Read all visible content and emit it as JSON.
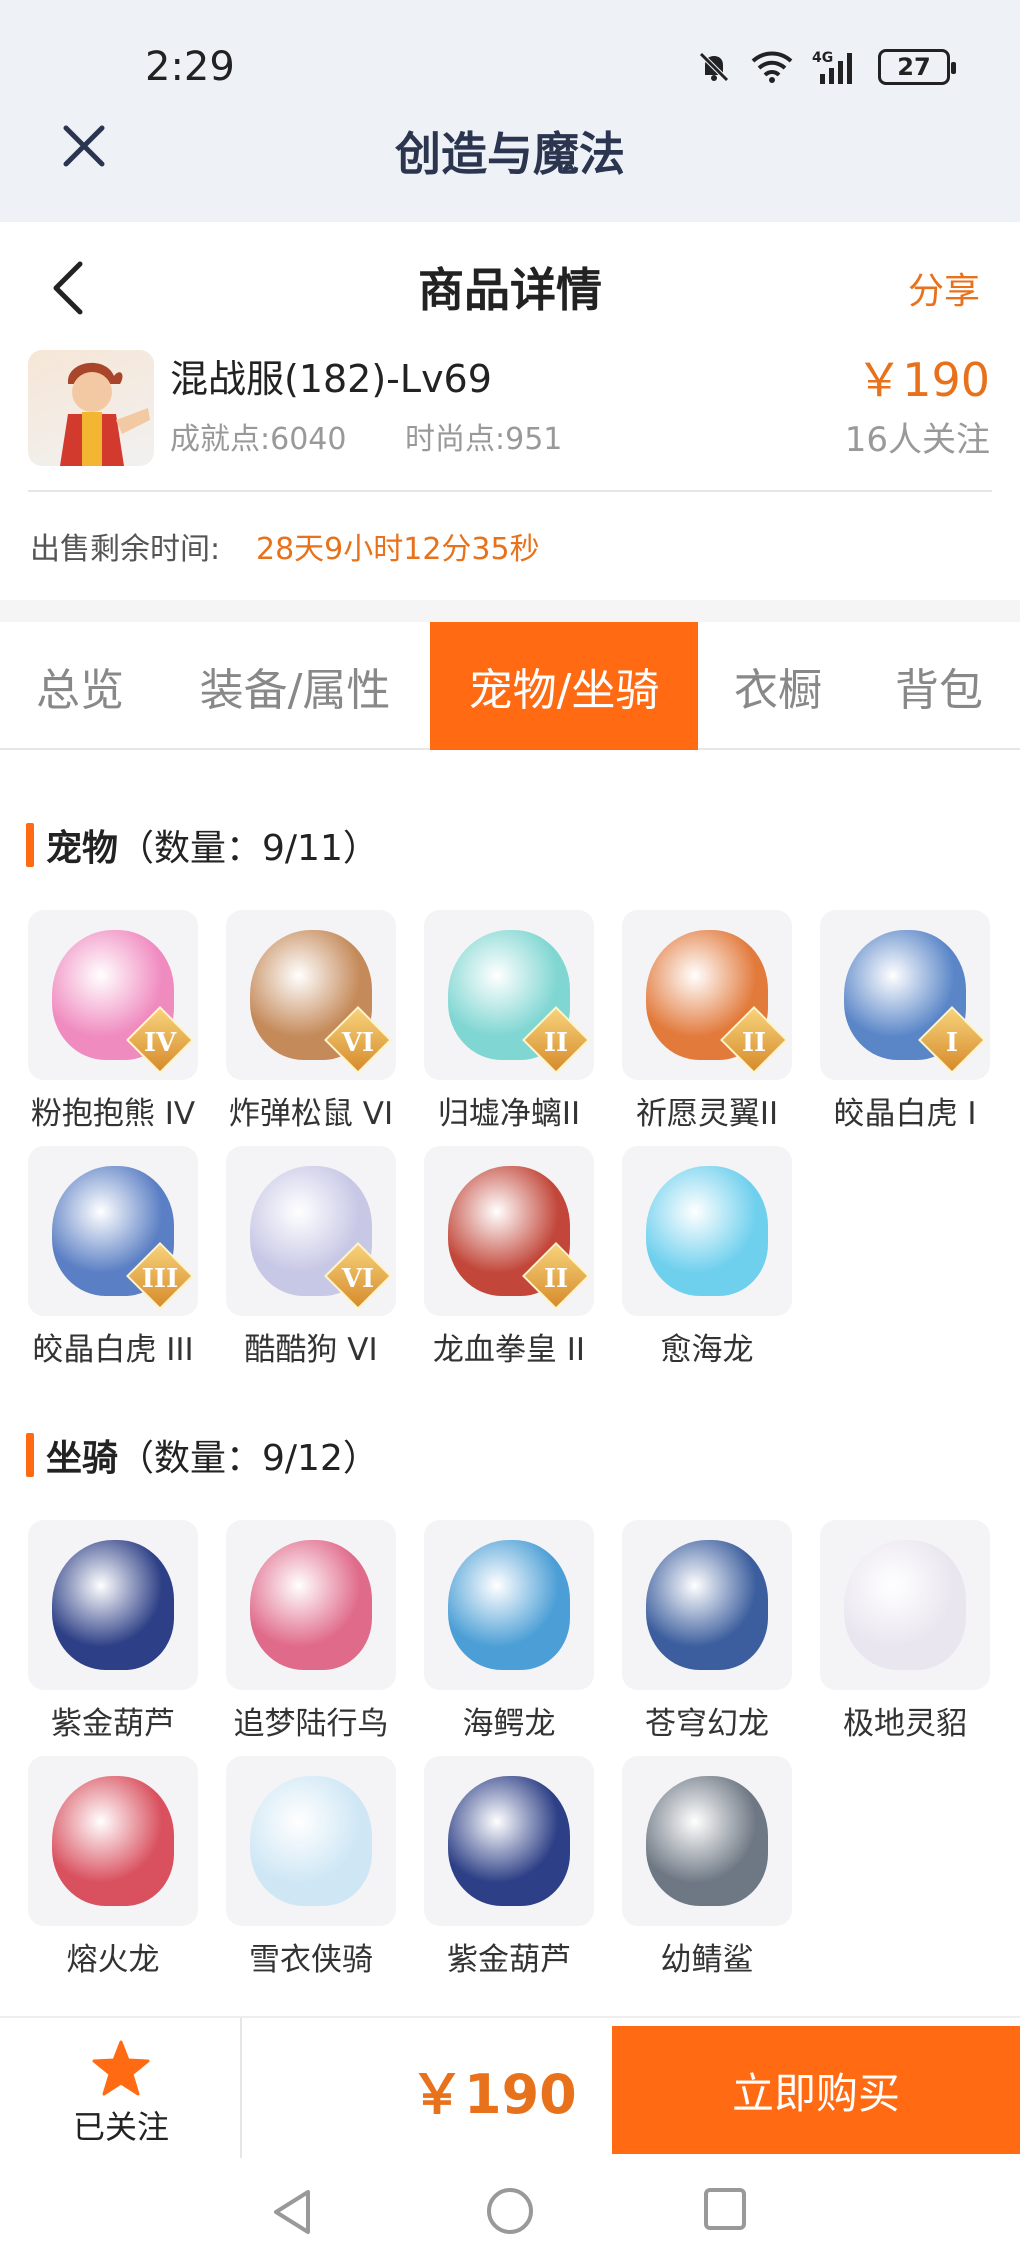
{
  "status_bar": {
    "time": "2:29",
    "battery": "27"
  },
  "app_header": {
    "title": "创造与魔法"
  },
  "page_header": {
    "title": "商品详情",
    "share_label": "分享"
  },
  "product": {
    "name": "混战服(182)-Lv69",
    "achievement": "成就点:6040",
    "fashion": "时尚点:951",
    "price": "￥190",
    "followers": "16人关注",
    "sale_time_label": "出售剩余时间:",
    "sale_time_value": "28天9小时12分35秒"
  },
  "tabs": [
    {
      "label": "总览",
      "active": false
    },
    {
      "label": "装备/属性",
      "active": false
    },
    {
      "label": "宠物/坐骑",
      "active": true
    },
    {
      "label": "衣橱",
      "active": false
    },
    {
      "label": "背包",
      "active": false
    }
  ],
  "pets": {
    "title": "宠物",
    "count": "（数量：9/11）",
    "items": [
      {
        "label": "粉抱抱熊 IV",
        "badge": "IV",
        "color": "#f08bc0"
      },
      {
        "label": "炸弹松鼠 VI",
        "badge": "VI",
        "color": "#c58a5a"
      },
      {
        "label": "归墟净螭II",
        "badge": "II",
        "color": "#7fd6d2"
      },
      {
        "label": "祈愿灵翼II",
        "badge": "II",
        "color": "#e27a3c"
      },
      {
        "label": "皎晶白虎 I",
        "badge": "I",
        "color": "#5a86c8"
      },
      {
        "label": "皎晶白虎 III",
        "badge": "III",
        "color": "#5b7fc4"
      },
      {
        "label": "酷酷狗 VI",
        "badge": "VI",
        "color": "#c7c7e6"
      },
      {
        "label": "龙血拳皇 II",
        "badge": "II",
        "color": "#c2473a"
      },
      {
        "label": "愈海龙",
        "badge": "",
        "color": "#6fd0ee"
      }
    ]
  },
  "mounts": {
    "title": "坐骑",
    "count": "（数量：9/12）",
    "items": [
      {
        "label": "紫金葫芦",
        "color": "#2d3f86"
      },
      {
        "label": "追梦陆行鸟",
        "color": "#e06a8a"
      },
      {
        "label": "海鳄龙",
        "color": "#4c9fd6"
      },
      {
        "label": "苍穹幻龙",
        "color": "#3c5e9e"
      },
      {
        "label": "极地灵貂",
        "color": "#eae6f0"
      },
      {
        "label": "熔火龙",
        "color": "#d9505e"
      },
      {
        "label": "雪衣侠骑",
        "color": "#cfe7f5"
      },
      {
        "label": "紫金葫芦",
        "color": "#2d3f86"
      },
      {
        "label": "幼鲭鲨",
        "color": "#6e7884"
      }
    ]
  },
  "bottom_bar": {
    "follow_label": "已关注",
    "price": "￥190",
    "buy_label": "立即购买"
  },
  "colors": {
    "accent": "#ff6a12",
    "price": "#e8721c"
  }
}
